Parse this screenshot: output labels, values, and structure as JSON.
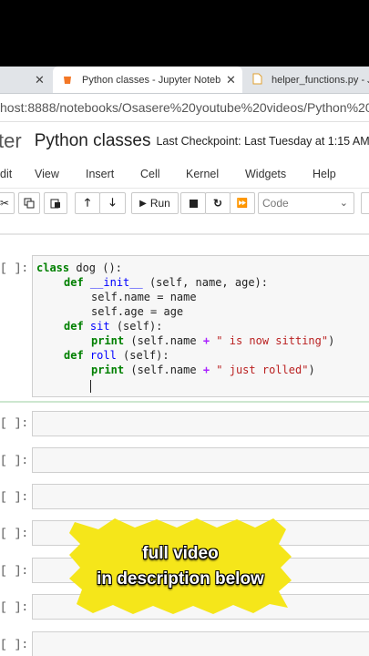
{
  "tabs": [
    {
      "label": "Python classes - Jupyter Notebo",
      "active": true
    },
    {
      "label": "helper_functions.py - Ju",
      "active": false
    }
  ],
  "url": "host:8888/notebooks/Osasere%20youtube%20videos/Python%20",
  "header": {
    "logo_fragment": "ter",
    "notebook_title": "Python classes",
    "checkpoint": "Last Checkpoint: Last Tuesday at 1:15 AM"
  },
  "menu": [
    "dit",
    "View",
    "Insert",
    "Cell",
    "Kernel",
    "Widgets",
    "Help"
  ],
  "toolbar": {
    "run_label": "Run",
    "cell_type": "Code"
  },
  "cells": {
    "prompt": "[ ]:",
    "code": {
      "l1_kw": "class",
      "l1_name": " dog ",
      "l1_rest": "():",
      "l2_kw": "def",
      "l2_fn": "__init__",
      "l2_rest": " (self, name, age):",
      "l3": "self.name = name",
      "l4": "self.age = age",
      "l5_kw": "def",
      "l5_fn": "sit",
      "l5_rest": " (self):",
      "l6_fn": "print",
      "l6_a": " (self.name ",
      "l6_op": "+",
      "l6_str": " \" is now sitting\"",
      "l6_end": ")",
      "l7_kw": "def",
      "l7_fn": "roll",
      "l7_rest": " (self):",
      "l8_fn": "print",
      "l8_a": " (self.name ",
      "l8_op": "+",
      "l8_str": " \" just rolled\"",
      "l8_end": ")"
    }
  },
  "overlay": {
    "line1": "full video",
    "line2": "in description below",
    "color": "#f5e61a"
  }
}
